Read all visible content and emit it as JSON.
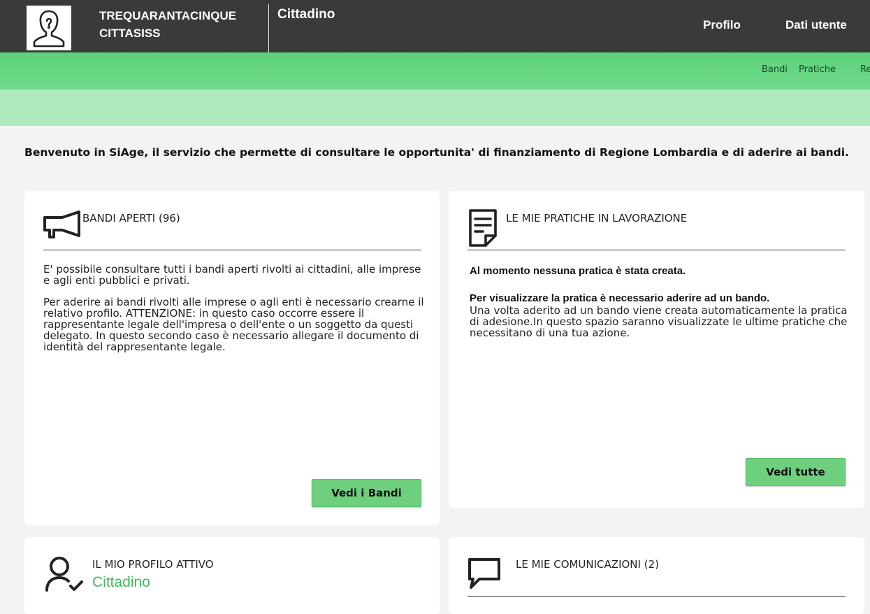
{
  "header": {
    "user_first": "TREQUARANTACINQUE",
    "user_last": "CITTASISS",
    "role": "Cittadino",
    "links": [
      "Profilo",
      "Dati utente"
    ]
  },
  "nav": {
    "items": [
      "Bandi",
      "Pratiche",
      "Re"
    ]
  },
  "welcome": "Benvenuto in SiAge, il servizio che permette di consultare le opportunita' di finanziamento di Regione Lombardia e di aderire ai bandi.",
  "cards": {
    "bandi": {
      "title": "BANDI APERTI (96)",
      "p1": "E' possibile consultare tutti i bandi aperti rivolti ai cittadini, alle imprese e agli enti pubblici e privati.",
      "p2": "Per aderire ai bandi rivolti alle imprese o agli enti è necessario crearne il relativo profilo. ATTENZIONE: in questo caso occorre essere il rappresentante legale dell'impresa o dell'ente o un soggetto da questi delegato. In questo secondo caso è necessario allegare il documento di identità del rappresentante legale.",
      "button": "Vedi i Bandi"
    },
    "pratiche": {
      "title": "LE MIE PRATICHE IN LAVORAZIONE",
      "none": "Al momento nessuna pratica è stata creata.",
      "hint_bold": "Per visualizzare la pratica è necessario aderire ad un bando.",
      "hint": "Una volta aderito ad un bando viene creata automaticamente la pratica di adesione.In questo spazio saranno visualizzate le ultime pratiche che necessitano di una tua azione.",
      "button": "Vedi tutte"
    },
    "profilo": {
      "title": "IL MIO PROFILO ATTIVO",
      "value": "Cittadino"
    },
    "comunicazioni": {
      "title": "LE MIE COMUNICAZIONI (2)"
    }
  },
  "colors": {
    "topbar": "#3a3a3a",
    "green": "#5ed17a",
    "green_light": "#b0e8bd",
    "button": "#6ecf7f",
    "accent_text": "#41b85c"
  },
  "icons": [
    "user-avatar-icon",
    "megaphone-icon",
    "document-icon",
    "user-check-icon",
    "chat-bubble-icon"
  ]
}
